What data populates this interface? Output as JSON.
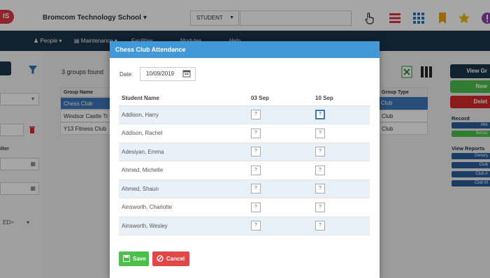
{
  "app": {
    "logo": "IS",
    "school": "Bromcom Technology School"
  },
  "toolbar": {
    "search_type": "STUDENT",
    "search_value": ""
  },
  "nav": {
    "items": [
      "People",
      "Maintenance",
      "Facilities",
      "Modules",
      "Help"
    ]
  },
  "groups": {
    "count_text": "3  groups found",
    "header": "Group Name",
    "type_header": "Group Type",
    "rows": [
      {
        "name": "Chess Club",
        "type": "Club",
        "selected": true
      },
      {
        "name": "Windsor Castle Tr",
        "type": "Club",
        "selected": false
      },
      {
        "name": "Y13 Fitness Club",
        "type": "Club",
        "selected": false
      }
    ]
  },
  "left": {
    "filter_label": "ilter",
    "select_value": "ED>"
  },
  "right": {
    "view_group": "View Gr",
    "new": "New",
    "delete": "Delet",
    "record_label": "Record",
    "attendance": "Atte",
    "behaviour": "Behav",
    "view_reports_label": "View Reports",
    "reports": [
      "Dietary",
      "Club",
      "Club A",
      "Club M"
    ]
  },
  "modal": {
    "title": "Chess Club Attendance",
    "date_label": "Date:",
    "date_value": "10/09/2019",
    "columns": [
      "Student Name",
      "03 Sep",
      "10 Sep"
    ],
    "students": [
      {
        "name": "Addison, Harry",
        "m1": "?",
        "m2": "?"
      },
      {
        "name": "Addison, Rachel",
        "m1": "?",
        "m2": "?"
      },
      {
        "name": "Adesiyan, Emma",
        "m1": "?",
        "m2": "?"
      },
      {
        "name": "Ahmed, Michelle",
        "m1": "?",
        "m2": "?"
      },
      {
        "name": "Ahmed, Shaun",
        "m1": "?",
        "m2": "?"
      },
      {
        "name": "Ainsworth, Charlotte",
        "m1": "?",
        "m2": "?"
      },
      {
        "name": "Ainsworth, Wesley",
        "m1": "?",
        "m2": "?"
      }
    ],
    "save_label": "Save",
    "cancel_label": "Cancel"
  },
  "colors": {
    "navbar": "#1d3349",
    "modal_header": "#4399d8",
    "save": "#4cbf4a",
    "cancel": "#e24747",
    "selected_row": "#3d78b8",
    "green_button": "#4cbf4a",
    "red_button": "#d42a2a"
  }
}
